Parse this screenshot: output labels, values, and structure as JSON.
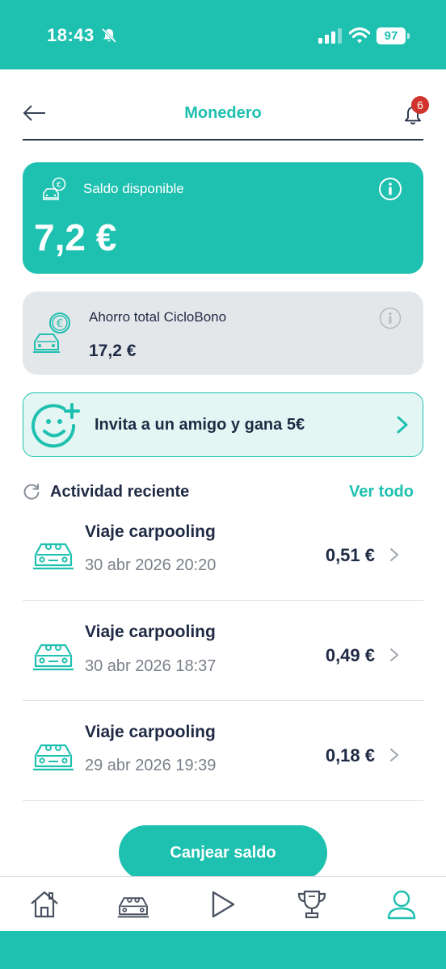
{
  "status_bar": {
    "time": "18:43",
    "battery": "97"
  },
  "header": {
    "title": "Monedero",
    "notification_count": "6"
  },
  "balance": {
    "label": "Saldo disponible",
    "value": "7,2 €"
  },
  "savings": {
    "label": "Ahorro total CicloBono",
    "value": "17,2 €"
  },
  "invite": {
    "text": "Invita a un amigo y gana 5€"
  },
  "activity": {
    "title": "Actividad reciente",
    "see_all": "Ver todo",
    "items": [
      {
        "title": "Viaje carpooling",
        "date": "30 abr 2026 20:20",
        "amount": "0,51 €"
      },
      {
        "title": "Viaje carpooling",
        "date": "30 abr 2026 18:37",
        "amount": "0,49 €"
      },
      {
        "title": "Viaje carpooling",
        "date": "29 abr 2026 19:39",
        "amount": "0,18 €"
      }
    ]
  },
  "redeem_button": "Canjear saldo",
  "tabs": [
    {
      "icon": "home-icon"
    },
    {
      "icon": "car-icon"
    },
    {
      "icon": "play-icon"
    },
    {
      "icon": "trophy-icon"
    },
    {
      "icon": "profile-icon",
      "active": true
    }
  ],
  "colors": {
    "accent": "#1ec0b0",
    "text": "#1f2a44",
    "muted": "#7a8089",
    "badge": "#d0342c",
    "card_grey": "#e4e7ea"
  }
}
